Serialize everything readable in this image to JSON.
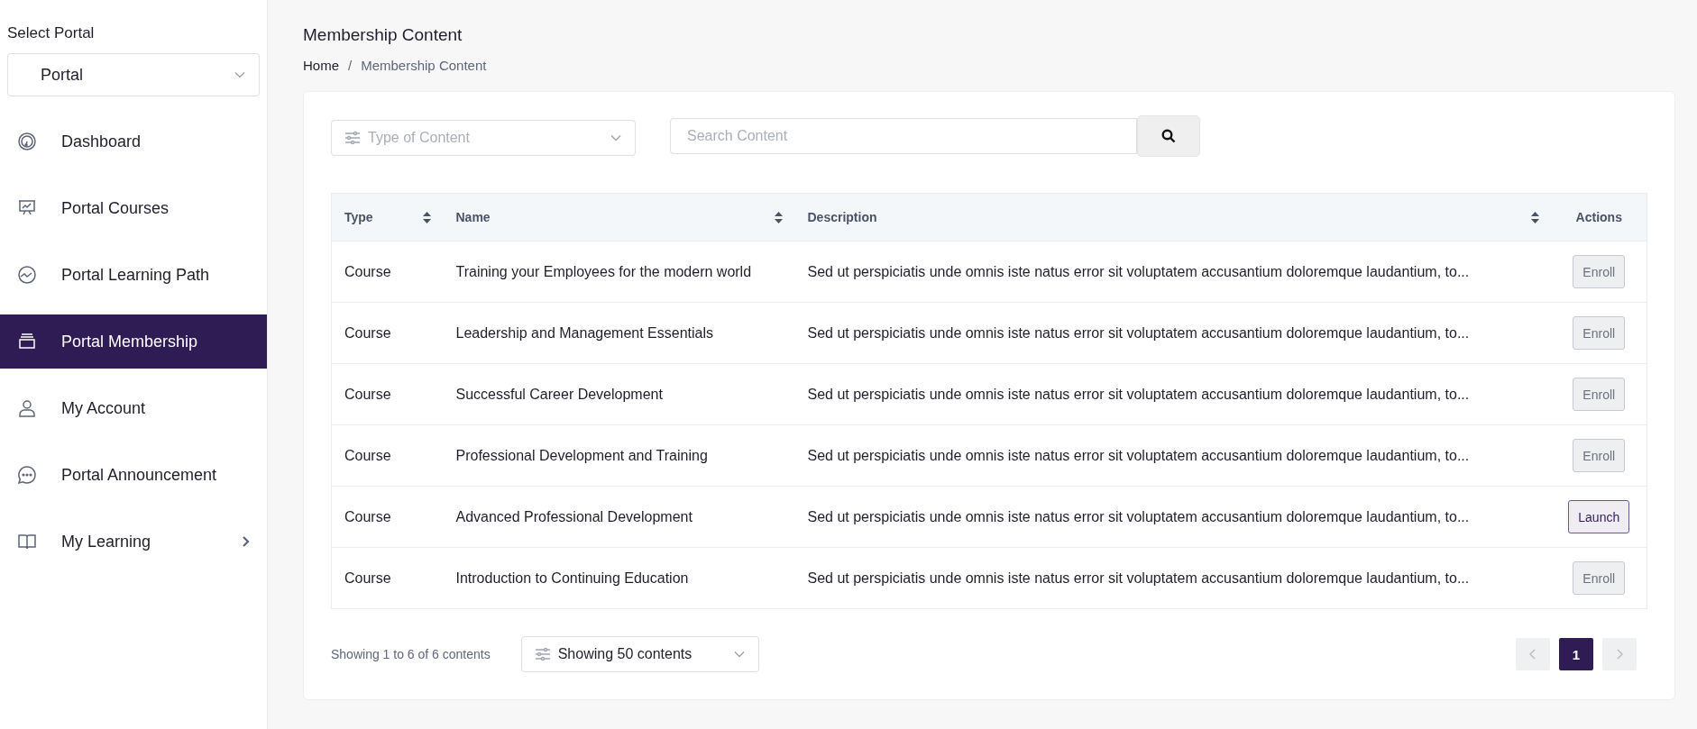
{
  "sidebar": {
    "portal_label": "Select Portal",
    "portal_select": {
      "value": "Portal"
    },
    "items": [
      {
        "label": "Dashboard",
        "selected": false,
        "has_submenu": false
      },
      {
        "label": "Portal Courses",
        "selected": false,
        "has_submenu": false
      },
      {
        "label": "Portal Learning Path",
        "selected": false,
        "has_submenu": false
      },
      {
        "label": "Portal Membership",
        "selected": true,
        "has_submenu": false
      },
      {
        "label": "My Account",
        "selected": false,
        "has_submenu": false
      },
      {
        "label": "Portal Announcement",
        "selected": false,
        "has_submenu": false
      },
      {
        "label": "My Learning",
        "selected": false,
        "has_submenu": true
      }
    ]
  },
  "page_title": "Membership Content",
  "breadcrumb": {
    "items": [
      "Home",
      "Membership Content"
    ],
    "separator": "/"
  },
  "filters": {
    "type_select": {
      "placeholder": "Type of Content"
    },
    "search": {
      "placeholder": "Search Content"
    }
  },
  "table": {
    "columns": [
      {
        "label": "Type",
        "sortable": true
      },
      {
        "label": "Name",
        "sortable": true
      },
      {
        "label": "Description",
        "sortable": true
      },
      {
        "label": "Actions",
        "sortable": false
      }
    ],
    "rows": [
      {
        "type": "Course",
        "name": "Training your Employees for the modern world",
        "description": "Sed ut perspiciatis unde omnis iste natus error sit voluptatem accusantium doloremque laudantium, to...",
        "action": {
          "kind": "enroll",
          "label": "Enroll"
        }
      },
      {
        "type": "Course",
        "name": "Leadership and Management Essentials",
        "description": "Sed ut perspiciatis unde omnis iste natus error sit voluptatem accusantium doloremque laudantium, to...",
        "action": {
          "kind": "enroll",
          "label": "Enroll"
        }
      },
      {
        "type": "Course",
        "name": "Successful Career Development",
        "description": "Sed ut perspiciatis unde omnis iste natus error sit voluptatem accusantium doloremque laudantium, to...",
        "action": {
          "kind": "enroll",
          "label": "Enroll"
        }
      },
      {
        "type": "Course",
        "name": "Professional Development and Training",
        "description": "Sed ut perspiciatis unde omnis iste natus error sit voluptatem accusantium doloremque laudantium, to...",
        "action": {
          "kind": "enroll",
          "label": "Enroll"
        }
      },
      {
        "type": "Course",
        "name": "Advanced Professional Development",
        "description": "Sed ut perspiciatis unde omnis iste natus error sit voluptatem accusantium doloremque laudantium, to...",
        "action": {
          "kind": "launch",
          "label": "Launch"
        }
      },
      {
        "type": "Course",
        "name": "Introduction to Continuing Education",
        "description": "Sed ut perspiciatis unde omnis iste natus error sit voluptatem accusantium doloremque laudantium, to...",
        "action": {
          "kind": "enroll",
          "label": "Enroll"
        }
      }
    ]
  },
  "footer": {
    "summary": "Showing 1 to 6 of 6 contents",
    "page_size_select": {
      "value": "Showing 50 contents"
    },
    "pagination": {
      "prev": {
        "disabled": true
      },
      "pages": [
        {
          "label": "1",
          "selected": true
        }
      ],
      "next": {
        "disabled": true
      }
    }
  }
}
